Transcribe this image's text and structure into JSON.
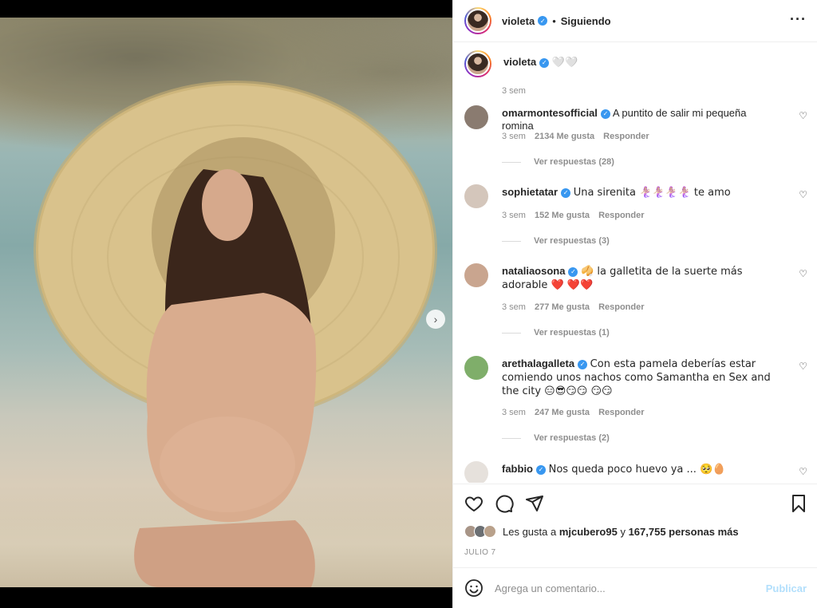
{
  "post": {
    "author": "violeta",
    "follow_separator": "•",
    "follow_status": "Siguiendo",
    "more_icon": "ellipsis-icon",
    "image_alt": "Foto de la publicación",
    "carousel_next": "›"
  },
  "caption": {
    "username": "violeta",
    "text": "🤍🤍",
    "time": "3 sem"
  },
  "comments": [
    {
      "username": "omarmontesofficial",
      "text": "A puntito de salir mi pequeña romina",
      "time": "3 sem",
      "likes": "2134 Me gusta",
      "reply": "Responder",
      "replies": "Ver respuestas (28)"
    },
    {
      "username": "sophietatar",
      "text": "Una sirenita 🧜🏼‍♀️🧜🏼‍♀️🧜🏼‍♀️🧜🏼‍♀️ te amo",
      "time": "3 sem",
      "likes": "152 Me gusta",
      "reply": "Responder",
      "replies": "Ver respuestas (3)"
    },
    {
      "username": "nataliaosona",
      "text": "🥠 la galletita de la suerte más adorable ❤️ ❤️❤️",
      "time": "3 sem",
      "likes": "277 Me gusta",
      "reply": "Responder",
      "replies": "Ver respuestas (1)"
    },
    {
      "username": "arethalagalleta",
      "text": "Con esta pamela deberías estar comiendo unos nachos como Samantha en Sex and the city 😑😎😏😏 😏😏",
      "time": "3 sem",
      "likes": "247 Me gusta",
      "reply": "Responder",
      "replies": "Ver respuestas (2)"
    },
    {
      "username": "fabbio",
      "text": "Nos queda poco huevo ya ... 🥺🥚"
    }
  ],
  "actions": {
    "like_icon": "heart-icon",
    "comment_icon": "comment-icon",
    "share_icon": "send-icon",
    "save_icon": "bookmark-icon",
    "likes_prefix": "Les gusta a",
    "likes_user": "mjcubero95",
    "likes_joiner": "y",
    "likes_count": "167,755 personas más",
    "date": "JULIO 7"
  },
  "add_comment": {
    "placeholder": "Agrega un comentario...",
    "publish": "Publicar"
  },
  "colors": {
    "verified": "#3897f0",
    "link_disabled": "#b2dffc",
    "muted": "#8e8e8e"
  }
}
